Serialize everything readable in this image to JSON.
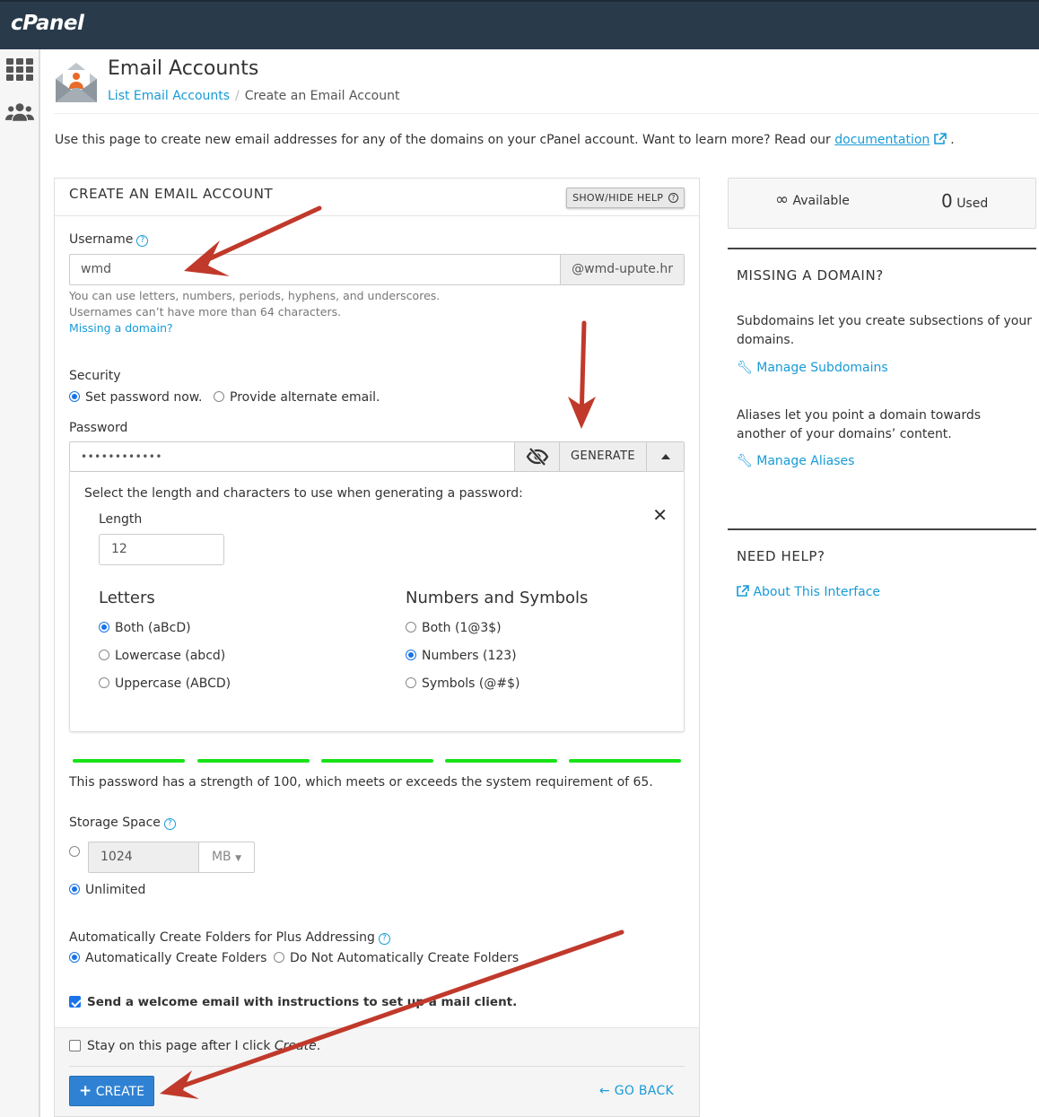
{
  "app": {
    "logo": "cPanel"
  },
  "header": {
    "title": "Email Accounts",
    "breadcrumb_link": "List Email Accounts",
    "breadcrumb_separator": "/",
    "breadcrumb_current": "Create an Email Account"
  },
  "intro": {
    "text": "Use this page to create new email addresses for any of the domains on your cPanel account. Want to learn more? Read our",
    "link": "documentation",
    "end": "."
  },
  "form": {
    "heading": "CREATE AN EMAIL ACCOUNT",
    "help_button": "SHOW/HIDE HELP",
    "username_label": "Username",
    "username_value": "wmd",
    "domain": "@wmd-upute.hr",
    "username_help1": "You can use letters, numbers, periods, hyphens, and underscores.",
    "username_help2": "Usernames can’t have more than 64 characters.",
    "missing_domain_link": "Missing a domain?",
    "security_label": "Security",
    "security_opt1": "Set password now.",
    "security_opt2": "Provide alternate email.",
    "password_label": "Password",
    "password_value": "••••••••••••",
    "generate_button": "GENERATE",
    "generator": {
      "intro": "Select the length and characters to use when generating a password:",
      "length_label": "Length",
      "length_value": "12",
      "letters_heading": "Letters",
      "letters_opts": [
        "Both (aBcD)",
        "Lowercase (abcd)",
        "Uppercase (ABCD)"
      ],
      "numbers_heading": "Numbers and Symbols",
      "numbers_opts": [
        "Both (1@3$)",
        "Numbers (123)",
        "Symbols (@#$)"
      ]
    },
    "strength_score": 100,
    "strength_text": "This password has a strength of 100, which meets or exceeds the system requirement of 65.",
    "storage_label": "Storage Space",
    "storage_value": "1024",
    "storage_unit": "MB",
    "storage_unlimited": "Unlimited",
    "plus_label": "Automatically Create Folders for Plus Addressing",
    "plus_opt1": "Automatically Create Folders",
    "plus_opt2": "Do Not Automatically Create Folders",
    "welcome_email": "Send a welcome email with instructions to set up a mail client.",
    "stay_text": "Stay on this page after I click",
    "stay_italic": "Create",
    "stay_end": ".",
    "create_button": "CREATE",
    "back_link": "GO BACK"
  },
  "sidebar": {
    "available_symbol": "∞",
    "available_label": "Available",
    "used_count": "0",
    "used_label": "Used",
    "missing_heading": "MISSING A DOMAIN?",
    "subdomains_text": "Subdomains let you create subsections of your domains.",
    "subdomains_link": "Manage Subdomains",
    "aliases_text": "Aliases let you point a domain towards another of your domains’ content.",
    "aliases_link": "Manage Aliases",
    "help_heading": "NEED HELP?",
    "about_link": "About This Interface"
  },
  "colors": {
    "topbar": "#293a4a",
    "link": "#179bd7",
    "primary_button": "#2f82d3",
    "strength_bar": "#18e318",
    "annotation_arrow": "#c0392b"
  }
}
